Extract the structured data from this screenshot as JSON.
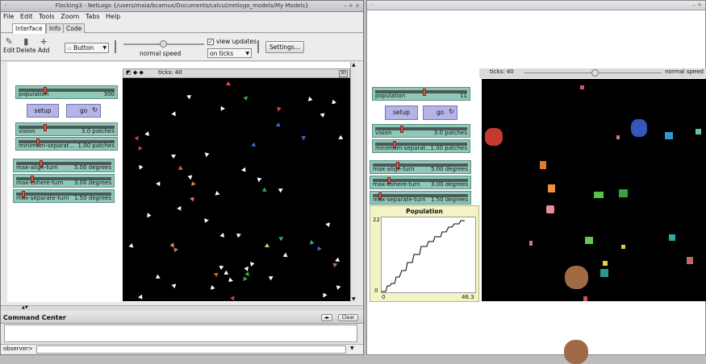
{
  "window_left": {
    "title": "Flocking3 - NetLogo {/users/maia/bcamux/Documents/calcul/netlogo_models/My Models}",
    "title_controls": [
      "◦",
      "–  +  ×"
    ],
    "menu": [
      "File",
      "Edit",
      "Tools",
      "Zoom",
      "Tabs",
      "Help"
    ],
    "tabs": [
      "Interface",
      "Info",
      "Code"
    ],
    "toolbar": {
      "edit": "Edit",
      "delete": "Delete",
      "add": "Add",
      "widget_type": "Button",
      "speed_label": "normal speed",
      "view_updates_label": "view updates",
      "view_updates_checked": true,
      "update_mode": "on ticks",
      "settings": "Settings..."
    },
    "sliders": [
      {
        "name": "population",
        "value": "300",
        "fraction": 0.3
      },
      {
        "name": "vision",
        "value": "3.0 patches",
        "fraction": 0.3
      },
      {
        "name": "minimum-separat...",
        "value": "1.00 patches",
        "fraction": 0.2
      },
      {
        "name": "max-align-turn",
        "value": "5.00 degrees",
        "fraction": 0.25
      },
      {
        "name": "max-cohere-turn",
        "value": "3.00 degrees",
        "fraction": 0.15
      },
      {
        "name": "max-separate-turn",
        "value": "1.50 degrees",
        "fraction": 0.08
      }
    ],
    "buttons": {
      "setup": "setup",
      "go": "go",
      "forever_icon": "↻"
    },
    "world": {
      "ticks_label": "ticks: 40",
      "threed": "3D"
    },
    "command_center": {
      "title": "Command Center",
      "clear": "Clear",
      "prompt": "observer>"
    }
  },
  "window_right": {
    "title_controls": [
      "◦",
      "– +"
    ],
    "sliders": [
      {
        "name": "population",
        "value": "11",
        "fraction": 0.3
      },
      {
        "name": "vision",
        "value": "3.0 patches",
        "fraction": 0.3
      },
      {
        "name": "minimum-separat...",
        "value": "1.00 patches",
        "fraction": 0.2
      },
      {
        "name": "max-align-turn",
        "value": "5.00 degrees",
        "fraction": 0.25
      },
      {
        "name": "max-cohere-turn",
        "value": "3.00 degrees",
        "fraction": 0.15
      },
      {
        "name": "max-separate-turn",
        "value": "1.50 degrees",
        "fraction": 0.08
      }
    ],
    "buttons": {
      "setup": "setup",
      "go": "go"
    },
    "world": {
      "ticks_label": "ticks: 40",
      "speed_label": "normal speed"
    },
    "plot": {
      "title": "Population",
      "y_max": "22",
      "y_min": "0",
      "x_min": "0",
      "x_max": "46.3"
    }
  },
  "colors": {
    "slider": "#8fc7b9",
    "button": "#b5b4e6",
    "world_bg": "#000000",
    "plot_bg": "#f4f3c6"
  }
}
